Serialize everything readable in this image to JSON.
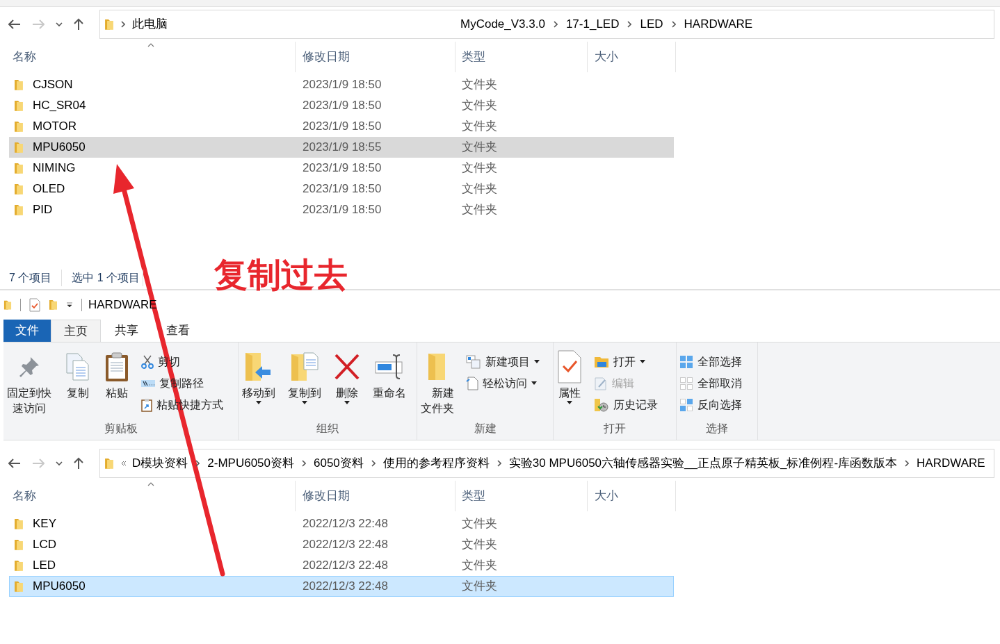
{
  "explorer_top": {
    "address": {
      "path_start": [
        "此电脑"
      ],
      "path_end": [
        "MyCode_V3.3.0",
        "17-1_LED",
        "LED",
        "HARDWARE"
      ]
    },
    "columns": [
      "名称",
      "修改日期",
      "类型",
      "大小"
    ],
    "files": [
      {
        "name": "CJSON",
        "modified": "2023/1/9 18:50",
        "type": "文件夹",
        "selected": false
      },
      {
        "name": "HC_SR04",
        "modified": "2023/1/9 18:50",
        "type": "文件夹",
        "selected": false
      },
      {
        "name": "MOTOR",
        "modified": "2023/1/9 18:50",
        "type": "文件夹",
        "selected": false
      },
      {
        "name": "MPU6050",
        "modified": "2023/1/9 18:55",
        "type": "文件夹",
        "selected": true
      },
      {
        "name": "NIMING",
        "modified": "2023/1/9 18:50",
        "type": "文件夹",
        "selected": false
      },
      {
        "name": "OLED",
        "modified": "2023/1/9 18:50",
        "type": "文件夹",
        "selected": false
      },
      {
        "name": "PID",
        "modified": "2023/1/9 18:50",
        "type": "文件夹",
        "selected": false
      }
    ],
    "status": {
      "count": "7 个项目",
      "selection": "选中 1 个项目"
    }
  },
  "annotation": {
    "text": "复制过去"
  },
  "explorer_bottom": {
    "title": "HARDWARE",
    "tabs": [
      {
        "label": "文件",
        "kind": "file",
        "selected": false
      },
      {
        "label": "主页",
        "kind": "tab",
        "selected": true
      },
      {
        "label": "共享",
        "kind": "tab",
        "selected": false
      },
      {
        "label": "查看",
        "kind": "tab",
        "selected": false
      }
    ],
    "ribbon": [
      {
        "label": "剪贴板",
        "items": [
          {
            "kind": "large",
            "label": "固定到快速访问",
            "dropdown": false
          },
          {
            "kind": "large",
            "label": "复制",
            "dropdown": false
          },
          {
            "kind": "large",
            "label": "粘贴",
            "dropdown": false
          },
          {
            "kind": "stack",
            "items": [
              {
                "label": "剪切",
                "dropdown": false,
                "disabled": false
              },
              {
                "label": "复制路径",
                "dropdown": false,
                "disabled": false
              },
              {
                "label": "粘贴快捷方式",
                "dropdown": false,
                "disabled": false
              }
            ]
          }
        ]
      },
      {
        "label": "组织",
        "items": [
          {
            "kind": "large",
            "label": "移动到",
            "dropdown": true
          },
          {
            "kind": "large",
            "label": "复制到",
            "dropdown": true
          },
          {
            "kind": "large",
            "label": "删除",
            "dropdown": true
          },
          {
            "kind": "large",
            "label": "重命名",
            "dropdown": false
          }
        ]
      },
      {
        "label": "新建",
        "items": [
          {
            "kind": "large",
            "label": "新建文件夹",
            "dropdown": false
          },
          {
            "kind": "stack",
            "items": [
              {
                "label": "新建项目",
                "dropdown": true,
                "disabled": false
              },
              {
                "label": "轻松访问",
                "dropdown": true,
                "disabled": false
              }
            ]
          }
        ]
      },
      {
        "label": "打开",
        "items": [
          {
            "kind": "large",
            "label": "属性",
            "dropdown": true
          },
          {
            "kind": "stack",
            "items": [
              {
                "label": "打开",
                "dropdown": true,
                "disabled": false
              },
              {
                "label": "编辑",
                "dropdown": false,
                "disabled": true
              },
              {
                "label": "历史记录",
                "dropdown": false,
                "disabled": false
              }
            ]
          }
        ]
      },
      {
        "label": "选择",
        "items": [
          {
            "kind": "stack",
            "items": [
              {
                "label": "全部选择",
                "dropdown": false,
                "disabled": false
              },
              {
                "label": "全部取消",
                "dropdown": false,
                "disabled": false
              },
              {
                "label": "反向选择",
                "dropdown": false,
                "disabled": false
              }
            ]
          }
        ]
      }
    ],
    "address": {
      "overflow": true,
      "segments": [
        "D模块资料",
        "2-MPU6050资料",
        "6050资料",
        "使用的参考程序资料",
        "实验30 MPU6050六轴传感器实验__正点原子精英板_标准例程-库函数版本",
        "HARDWARE"
      ]
    },
    "columns": [
      "名称",
      "修改日期",
      "类型",
      "大小"
    ],
    "files": [
      {
        "name": "KEY",
        "modified": "2022/12/3 22:48",
        "type": "文件夹",
        "selected": false
      },
      {
        "name": "LCD",
        "modified": "2022/12/3 22:48",
        "type": "文件夹",
        "selected": false
      },
      {
        "name": "LED",
        "modified": "2022/12/3 22:48",
        "type": "文件夹",
        "selected": false
      },
      {
        "name": "MPU6050",
        "modified": "2022/12/3 22:48",
        "type": "文件夹",
        "selected": true
      }
    ]
  }
}
